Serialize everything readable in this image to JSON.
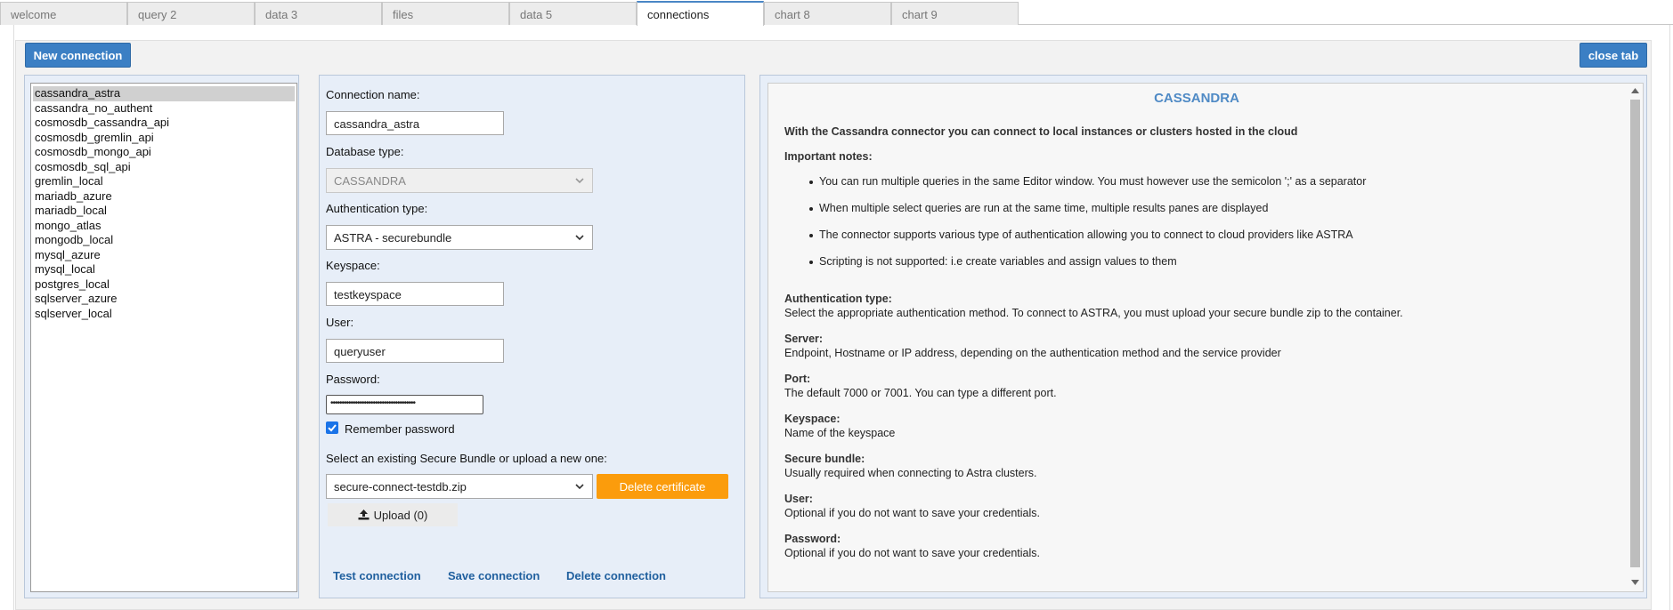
{
  "tabs": [
    {
      "label": "welcome",
      "active": false
    },
    {
      "label": "query 2",
      "active": false
    },
    {
      "label": "data 3",
      "active": false
    },
    {
      "label": "files",
      "active": false
    },
    {
      "label": "data 5",
      "active": false
    },
    {
      "label": "connections",
      "active": true
    },
    {
      "label": "chart 8",
      "active": false
    },
    {
      "label": "chart 9",
      "active": false
    }
  ],
  "toolbar": {
    "new_connection_label": "New connection",
    "close_tab_label": "close tab"
  },
  "connections": {
    "selected": "cassandra_astra",
    "items": [
      "cassandra_astra",
      "cassandra_no_authent",
      "cosmosdb_cassandra_api",
      "cosmosdb_gremlin_api",
      "cosmosdb_mongo_api",
      "cosmosdb_sql_api",
      "gremlin_local",
      "mariadb_azure",
      "mariadb_local",
      "mongo_atlas",
      "mongodb_local",
      "mysql_azure",
      "mysql_local",
      "postgres_local",
      "sqlserver_azure",
      "sqlserver_local"
    ]
  },
  "form": {
    "connection_name_label": "Connection name:",
    "connection_name_value": "cassandra_astra",
    "database_type_label": "Database type:",
    "database_type_value": "CASSANDRA",
    "auth_type_label": "Authentication type:",
    "auth_type_value": "ASTRA - securebundle",
    "keyspace_label": "Keyspace:",
    "keyspace_value": "testkeyspace",
    "user_label": "User:",
    "user_value": "queryuser",
    "password_label": "Password:",
    "password_mask": "••••••••••••••••••••••••••••••••••••••",
    "remember_password_label": "Remember password",
    "remember_password_checked": true,
    "bundle_label": "Select an existing Secure Bundle or upload a new one:",
    "bundle_value": "secure-connect-testdb.zip",
    "delete_certificate_label": "Delete certificate",
    "upload_label": "Upload (0)",
    "test_connection_label": "Test connection",
    "save_connection_label": "Save connection",
    "delete_connection_label": "Delete connection"
  },
  "info": {
    "title": "CASSANDRA",
    "intro": "With the Cassandra connector you can connect to local instances or clusters hosted in the cloud",
    "notes_heading": "Important notes:",
    "notes": [
      "You can run multiple queries in the same Editor window. You must however use the semicolon ';' as a separator",
      "When multiple select queries are run at the same time, multiple results panes are displayed",
      "The connector supports various type of authentication allowing you to connect to cloud providers like ASTRA",
      "Scripting is not supported: i.e create variables and assign values to them"
    ],
    "sections": [
      {
        "heading": "Authentication type:",
        "text": "Select the appropriate authentication method. To connect to ASTRA, you must upload your secure bundle zip to the container."
      },
      {
        "heading": "Server:",
        "text": "Endpoint, Hostname or IP address, depending on the authentication method and the service provider"
      },
      {
        "heading": "Port:",
        "text": "The default 7000 or 7001. You can type a different port."
      },
      {
        "heading": "Keyspace:",
        "text": "Name of the keyspace"
      },
      {
        "heading": "Secure bundle:",
        "text": "Usually required when connecting to Astra clusters."
      },
      {
        "heading": "User:",
        "text": "Optional if you do not want to save your credentials."
      },
      {
        "heading": "Password:",
        "text": "Optional if you do not want to save your credentials."
      }
    ]
  }
}
